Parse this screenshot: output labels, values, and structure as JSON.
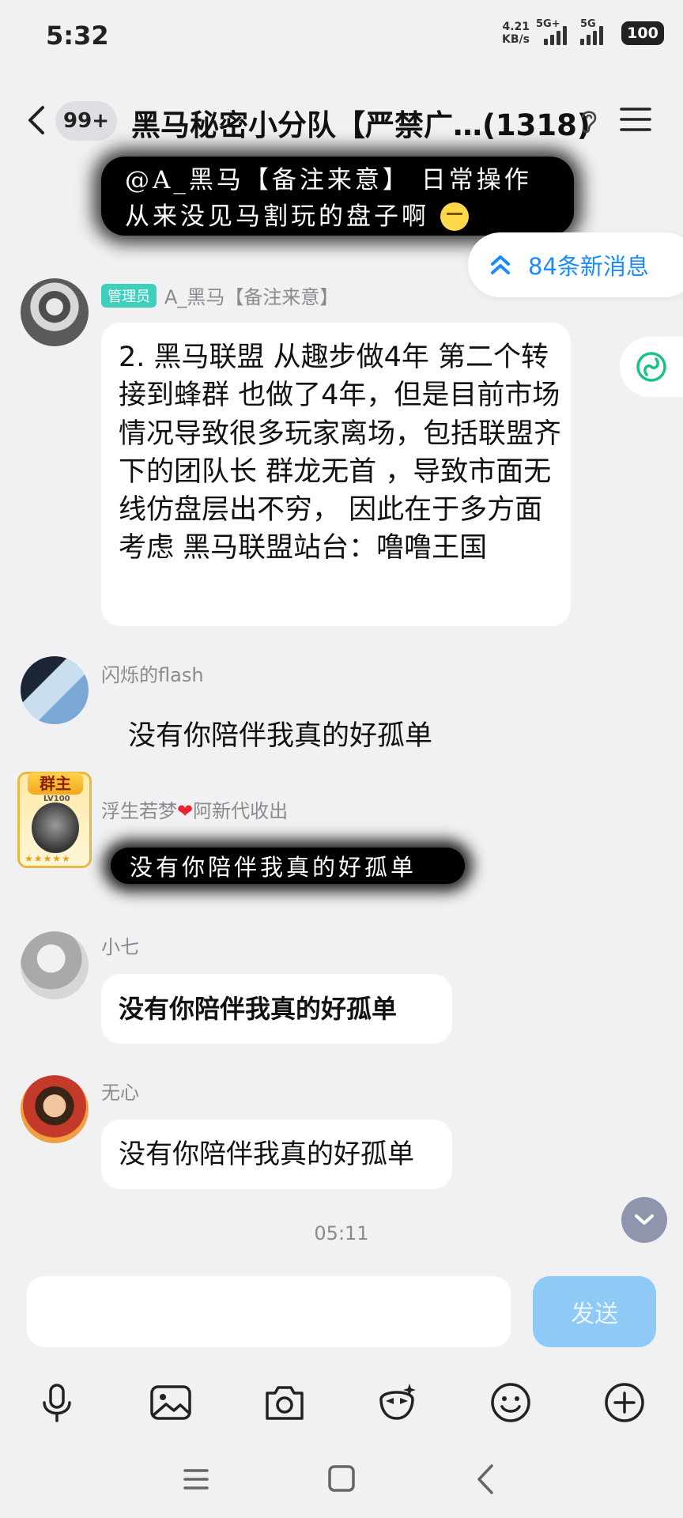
{
  "status_bar": {
    "time": "5:32",
    "net_speed_value": "4.21",
    "net_speed_unit": "KB/s",
    "sim1_type": "5G+",
    "sim2_type": "5G",
    "battery": "100"
  },
  "header": {
    "unread_count": "99+",
    "title": "黑马秘密小分队【严禁广…(1318)"
  },
  "pinned_quote": {
    "line1": "@A_黑马【备注来意】 日常操作",
    "line2": "从来没见马割玩的盘子啊"
  },
  "new_messages_pill": {
    "label": "84条新消息"
  },
  "messages": [
    {
      "badge": "管理员",
      "sender": "A_黑马【备注来意】",
      "text": "2. 黑马联盟 从趣步做4年 第二个转接到蜂群 也做了4年，但是目前市场情况导致很多玩家离场，包括联盟齐下的团队长 群龙无首 ，导致市面无线仿盘层出不穷， 因此在于多方面考虑 黑马联盟站台：噜噜王国"
    },
    {
      "sender": "闪烁的flash",
      "text": "没有你陪伴我真的好孤单"
    },
    {
      "owner_tag": "群主",
      "owner_level": "LV100",
      "owner_stars": "★★★★★",
      "sender_prefix": "浮生若梦",
      "sender_suffix": "阿新代收出",
      "text": "没有你陪伴我真的好孤单"
    },
    {
      "sender": "小七",
      "text": "没有你陪伴我真的好孤单"
    },
    {
      "sender": "无心",
      "text": "没有你陪伴我真的好孤单"
    }
  ],
  "time_divider": "05:11",
  "input": {
    "placeholder": "",
    "send_label": "发送"
  },
  "icons": {
    "back": "back-arrow-icon",
    "ear": "earpiece-icon",
    "menu": "menu-icon",
    "new_msg": "double-chevron-up-icon",
    "float_app": "app-icon",
    "scroll_down": "chevron-down-icon",
    "toolbar": [
      "microphone-icon",
      "image-icon",
      "camera-icon",
      "sticker-icon",
      "emoji-icon",
      "plus-icon"
    ]
  },
  "colors": {
    "accent": "#1a8cff",
    "send_button": "#8fcaf7",
    "admin_badge": "#3fd0bd"
  }
}
